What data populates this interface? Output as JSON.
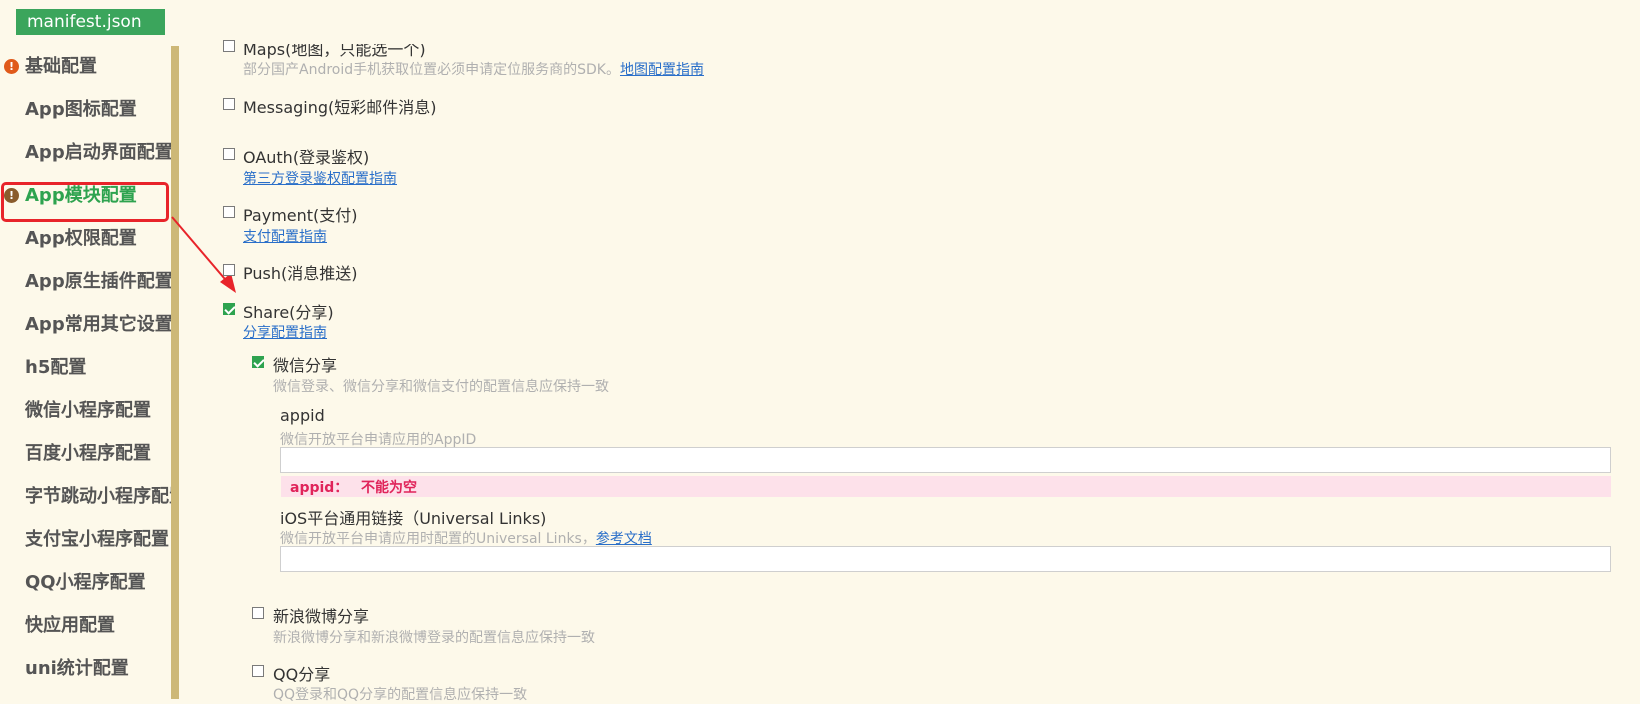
{
  "tab": {
    "title": "manifest.json"
  },
  "sidebar": {
    "items": [
      {
        "label": "基础配置"
      },
      {
        "label": "App图标配置"
      },
      {
        "label": "App启动界面配置"
      },
      {
        "label": "App模块配置"
      },
      {
        "label": "App权限配置"
      },
      {
        "label": "App原生插件配置"
      },
      {
        "label": "App常用其它设置"
      },
      {
        "label": "h5配置"
      },
      {
        "label": "微信小程序配置"
      },
      {
        "label": "百度小程序配置"
      },
      {
        "label": "字节跳动小程序配置"
      },
      {
        "label": "支付宝小程序配置"
      },
      {
        "label": "QQ小程序配置"
      },
      {
        "label": "快应用配置"
      },
      {
        "label": "uni统计配置"
      }
    ]
  },
  "modules": {
    "maps": {
      "label": "Maps(地图，只能选一个)",
      "desc": "部分国产Android手机获取位置必须申请定位服务商的SDK。",
      "link": "地图配置指南",
      "checked": false
    },
    "messaging": {
      "label": "Messaging(短彩邮件消息)",
      "checked": false
    },
    "oauth": {
      "label": "OAuth(登录鉴权)",
      "link": "第三方登录鉴权配置指南",
      "checked": false
    },
    "payment": {
      "label": "Payment(支付)",
      "link": "支付配置指南",
      "checked": false
    },
    "push": {
      "label": "Push(消息推送)",
      "checked": false
    },
    "share": {
      "label": "Share(分享)",
      "link": "分享配置指南",
      "checked": true
    }
  },
  "share": {
    "weixin": {
      "label": "微信分享",
      "desc": "微信登录、微信分享和微信支付的配置信息应保持一致",
      "checked": true,
      "appid": {
        "label": "appid",
        "desc": "微信开放平台申请应用的AppID",
        "value": ""
      },
      "error": {
        "key": "appid：",
        "message": "不能为空"
      },
      "universal_links": {
        "label": "iOS平台通用链接（Universal Links)",
        "desc": "微信开放平台申请应用时配置的Universal Links，",
        "link": "参考文档",
        "value": ""
      }
    },
    "sina": {
      "label": "新浪微博分享",
      "desc": "新浪微博分享和新浪微博登录的配置信息应保持一致",
      "checked": false
    },
    "qq": {
      "label": "QQ分享",
      "desc": "QQ登录和QQ分享的配置信息应保持一致",
      "checked": false
    }
  },
  "colors": {
    "accent": "#2ea34f",
    "highlight": "#e8242a",
    "error": "#e0245a",
    "link": "#2a6fc9"
  },
  "icons": {
    "alert": "exclamation-circle-icon",
    "arrow": "red-arrow-annotation"
  }
}
